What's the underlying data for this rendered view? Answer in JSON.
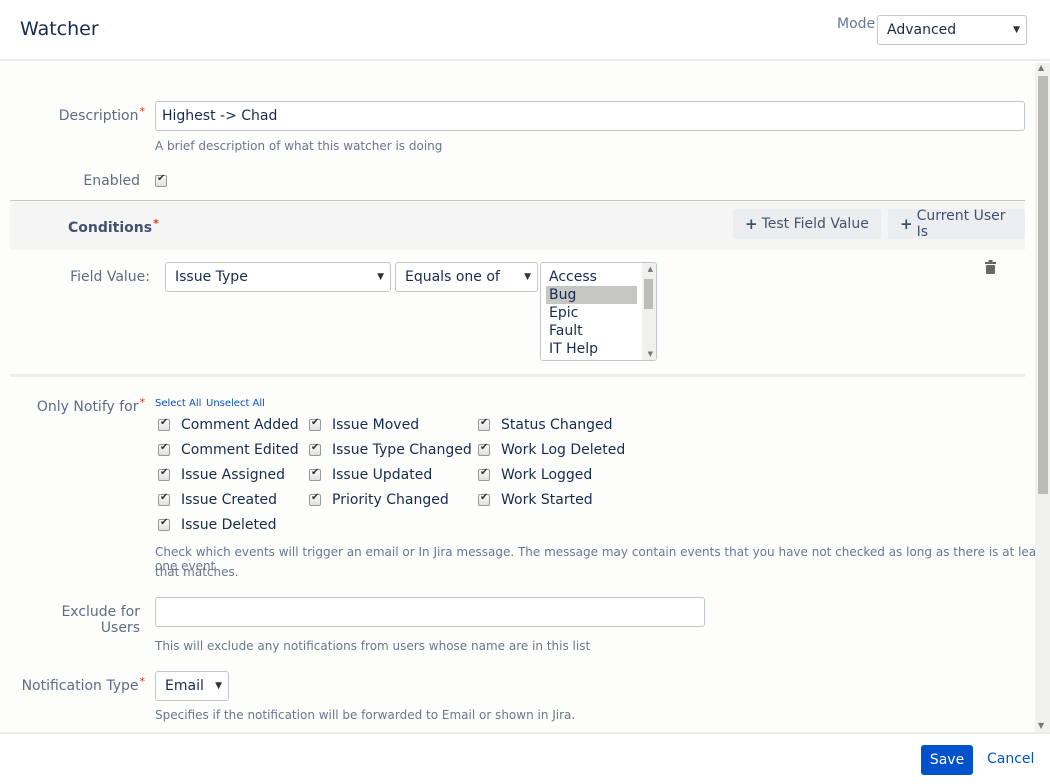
{
  "header": {
    "title": "Watcher",
    "mode_label": "Mode",
    "mode_value": "Advanced"
  },
  "form": {
    "description": {
      "label": "Description",
      "value": "Highest -> Chad",
      "hint": "A brief description of what this watcher is doing"
    },
    "enabled": {
      "label": "Enabled",
      "checked": true
    },
    "conditions": {
      "label": "Conditions",
      "test_field_button": "Test Field Value",
      "current_user_button": "Current User Is",
      "field_value_label": "Field Value:",
      "field_select": "Issue Type",
      "operator_select": "Equals one of",
      "options": [
        "Access",
        "Bug",
        "Epic",
        "Fault",
        "IT Help"
      ],
      "selected_option": "Bug"
    },
    "notify": {
      "label": "Only Notify for",
      "select_all": "Select All",
      "unselect_all": "Unselect All",
      "events": [
        [
          "Comment Added",
          "Comment Edited",
          "Issue Assigned",
          "Issue Created",
          "Issue Deleted"
        ],
        [
          "Issue Moved",
          "Issue Type Changed",
          "Issue Updated",
          "Priority Changed"
        ],
        [
          "Status Changed",
          "Work Log Deleted",
          "Work Logged",
          "Work Started"
        ]
      ],
      "hint_line1": "Check which events will trigger an email or In Jira message. The message may contain events that you have not checked as long as there is at least one event",
      "hint_line2": "that matches."
    },
    "exclude": {
      "label": "Exclude for Users",
      "value": "",
      "hint": "This will exclude any notifications from users whose name are in this list"
    },
    "notification_type": {
      "label": "Notification Type",
      "value": "Email",
      "hint": "Specifies if the notification will be forwarded to Email or shown in Jira."
    }
  },
  "footer": {
    "save": "Save",
    "cancel": "Cancel"
  },
  "colors": {
    "primary": "#0052cc",
    "required": "#de350b"
  }
}
